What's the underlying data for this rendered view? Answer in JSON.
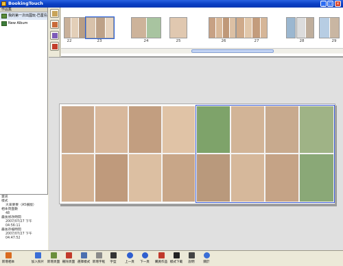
{
  "window": {
    "title": "BookingTouch"
  },
  "sidebar": {
    "header": "作品集",
    "albums": [
      {
        "label": "我的第一次出國玩-巴厘島"
      },
      {
        "label": "New Album"
      }
    ]
  },
  "info": {
    "header": "資訊",
    "rows": [
      {
        "label": "樣式",
        "value": "大來麥麥（A5橫版）"
      },
      {
        "label": "相本頁面數",
        "value": "48"
      },
      {
        "label": "最後修改時間",
        "value": "2007/07/27 下午 04:56:11"
      },
      {
        "label": "最後存檔時間",
        "value": "2007/07/27 下午 04:47:52"
      }
    ]
  },
  "strip": {
    "pages": [
      "22",
      "23",
      "24",
      "25",
      "26",
      "27",
      "28",
      "29"
    ]
  },
  "toolbar": {
    "buttons": [
      {
        "label": "新增相本",
        "icon": "new-album-icon",
        "color": "#d96b1e"
      },
      {
        "label": "加入照片",
        "icon": "add-photo-icon",
        "color": "#3a6ed6"
      },
      {
        "label": "新增頁面",
        "icon": "add-page-icon",
        "color": "#6b8f3a"
      },
      {
        "label": "刪除頁面",
        "icon": "delete-page-icon",
        "color": "#c23b2b"
      },
      {
        "label": "選擇樣式",
        "icon": "style-icon",
        "color": "#4b6fb0"
      },
      {
        "label": "新增字框",
        "icon": "text-frame-icon",
        "color": "#8a8a8a"
      },
      {
        "label": "字型",
        "icon": "font-icon",
        "color": "#333333"
      },
      {
        "label": "上一頁",
        "icon": "prev-page-icon",
        "color": "#2f5fcf"
      },
      {
        "label": "下一頁",
        "icon": "next-page-icon",
        "color": "#2f5fcf"
      },
      {
        "label": "購買作品",
        "icon": "purchase-icon",
        "color": "#c0392b"
      },
      {
        "label": "樣式下載",
        "icon": "download-icon",
        "color": "#222222"
      },
      {
        "label": "說明",
        "icon": "help-icon",
        "color": "#444444"
      },
      {
        "label": "關於",
        "icon": "about-icon",
        "color": "#3a6ed6"
      }
    ]
  },
  "colors": {
    "titlebar": "#0a3fc4",
    "selection": "#2b5fd9"
  }
}
